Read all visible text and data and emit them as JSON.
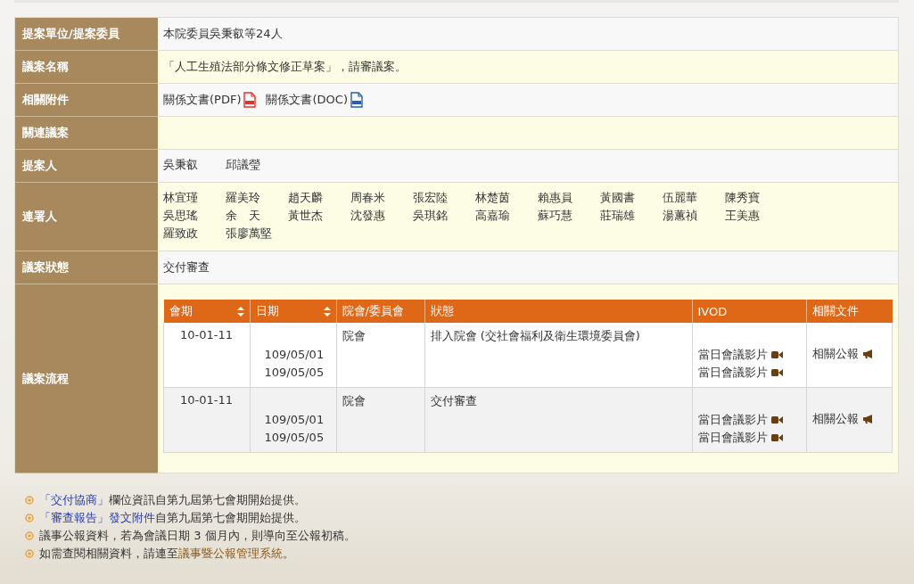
{
  "fields": [
    {
      "kind": "text",
      "label": "提案單位/提案委員",
      "value": "本院委員吳秉叡等24人"
    },
    {
      "kind": "text",
      "label": "議案名稱",
      "value": "「人工生殖法部分條文修正草案」，請審議案。"
    },
    {
      "kind": "attachments",
      "label": "相關附件",
      "files": [
        {
          "text": "關係文書(PDF)",
          "kind": "pdf"
        },
        {
          "text": "關係文書(DOC)",
          "kind": "doc"
        }
      ]
    },
    {
      "kind": "empty",
      "label": "關連議案"
    },
    {
      "kind": "names",
      "label": "提案人",
      "names": [
        "吳秉叡",
        "邱議瑩"
      ]
    },
    {
      "kind": "names",
      "label": "連署人",
      "names": [
        "林宜瑾",
        "羅美玲",
        "趙天麟",
        "周春米",
        "張宏陸",
        "林楚茵",
        "賴惠員",
        "黃國書",
        "伍麗華",
        "陳秀寶",
        "吳思瑤",
        "余　天",
        "黃世杰",
        "沈發惠",
        "吳琪銘",
        "高嘉瑜",
        "蘇巧慧",
        "莊瑞雄",
        "湯蕙禎",
        "王美惠",
        "羅致政",
        "張廖萬堅"
      ]
    },
    {
      "kind": "text",
      "label": "議案狀態",
      "value": "交付審查"
    },
    {
      "kind": "process",
      "label": "議案流程",
      "table": {
        "columns": [
          {
            "label": "會期",
            "sortable": true
          },
          {
            "label": "日期",
            "sortable": true
          },
          {
            "label": "院會/委員會",
            "sortable": false
          },
          {
            "label": "狀態",
            "sortable": false
          },
          {
            "label": "IVOD",
            "sortable": false
          },
          {
            "label": "相關文件",
            "sortable": false
          }
        ],
        "rows": [
          {
            "session": "10-01-11",
            "dates": [
              "109/05/01",
              "109/05/05"
            ],
            "venue": "院會",
            "status": "排入院會 (交社會福利及衛生環境委員會)",
            "videos": [
              "當日會議影片",
              "當日會議影片"
            ],
            "document": "相關公報"
          },
          {
            "session": "10-01-11",
            "dates": [
              "109/05/01",
              "109/05/05"
            ],
            "venue": "院會",
            "status": "交付審查",
            "videos": [
              "當日會議影片",
              "當日會議影片"
            ],
            "document": "相關公報"
          }
        ]
      }
    }
  ],
  "notes": [
    [
      {
        "kind": "link",
        "text": "「交付協商」"
      },
      {
        "kind": "plain",
        "text": "欄位資訊自第九屆第七會期開始提供。"
      }
    ],
    [
      {
        "kind": "link",
        "text": "「審查報告」發文附件"
      },
      {
        "kind": "plain",
        "text": "自第九屆第七會期開始提供。"
      }
    ],
    [
      {
        "kind": "plain",
        "text": "議事公報資料，若為會議日期 3 個月內，則導向至公報初稿。"
      }
    ],
    [
      {
        "kind": "plain",
        "text": "如需查閱相關資料，請連至"
      },
      {
        "kind": "system_link",
        "text": "議事暨公報管理系統"
      },
      {
        "kind": "plain",
        "text": "。"
      }
    ]
  ]
}
